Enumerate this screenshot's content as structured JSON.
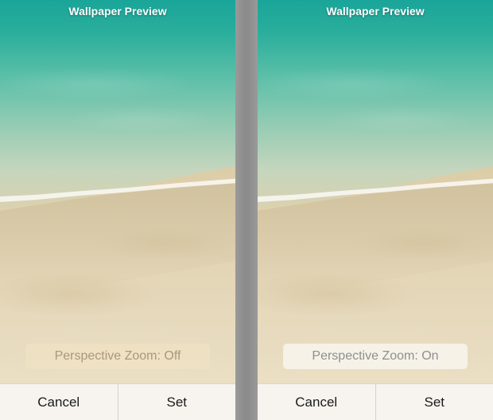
{
  "screens": [
    {
      "title": "Wallpaper Preview",
      "perspective_zoom": {
        "label": "Perspective Zoom: Off",
        "state": "off"
      },
      "buttons": {
        "cancel": "Cancel",
        "set": "Set"
      }
    },
    {
      "title": "Wallpaper Preview",
      "perspective_zoom": {
        "label": "Perspective Zoom: On",
        "state": "on"
      },
      "buttons": {
        "cancel": "Cancel",
        "set": "Set"
      }
    }
  ],
  "colors": {
    "water": "#1aa59a",
    "sand": "#dccda8",
    "title_text": "#ffffff",
    "action_bar": "#f7f5f0",
    "toggle_off_text": "#a9987c",
    "toggle_on_text": "#8f8f8f"
  }
}
